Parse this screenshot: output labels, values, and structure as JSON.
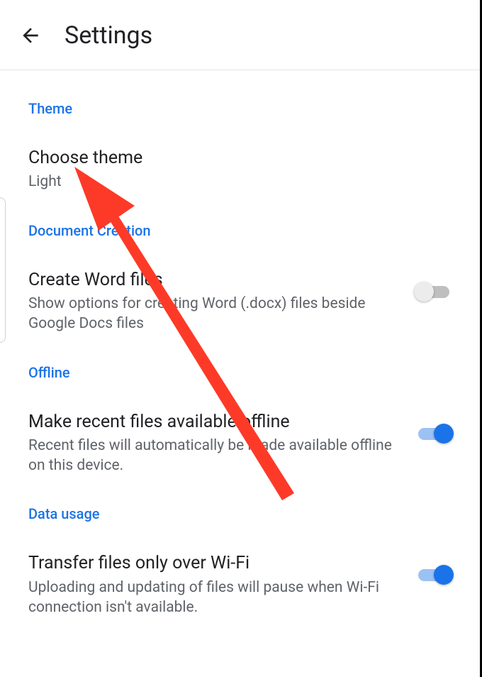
{
  "header": {
    "title": "Settings"
  },
  "sections": {
    "theme": {
      "header": "Theme",
      "choose_theme_title": "Choose theme",
      "choose_theme_value": "Light"
    },
    "doc_creation": {
      "header": "Document Creation",
      "create_word_title": "Create Word files",
      "create_word_desc": "Show options for creating Word (.docx) files beside Google Docs files",
      "create_word_enabled": false
    },
    "offline": {
      "header": "Offline",
      "recent_title": "Make recent files available offline",
      "recent_desc": "Recent files will automatically be made available offline on this device.",
      "recent_enabled": true
    },
    "data_usage": {
      "header": "Data usage",
      "wifi_title": "Transfer files only over Wi-Fi",
      "wifi_desc": "Uploading and updating of files will pause when Wi-Fi connection isn't available.",
      "wifi_enabled": true
    }
  },
  "colors": {
    "accent": "#1a73e8",
    "annotation": "#fd3a27"
  }
}
